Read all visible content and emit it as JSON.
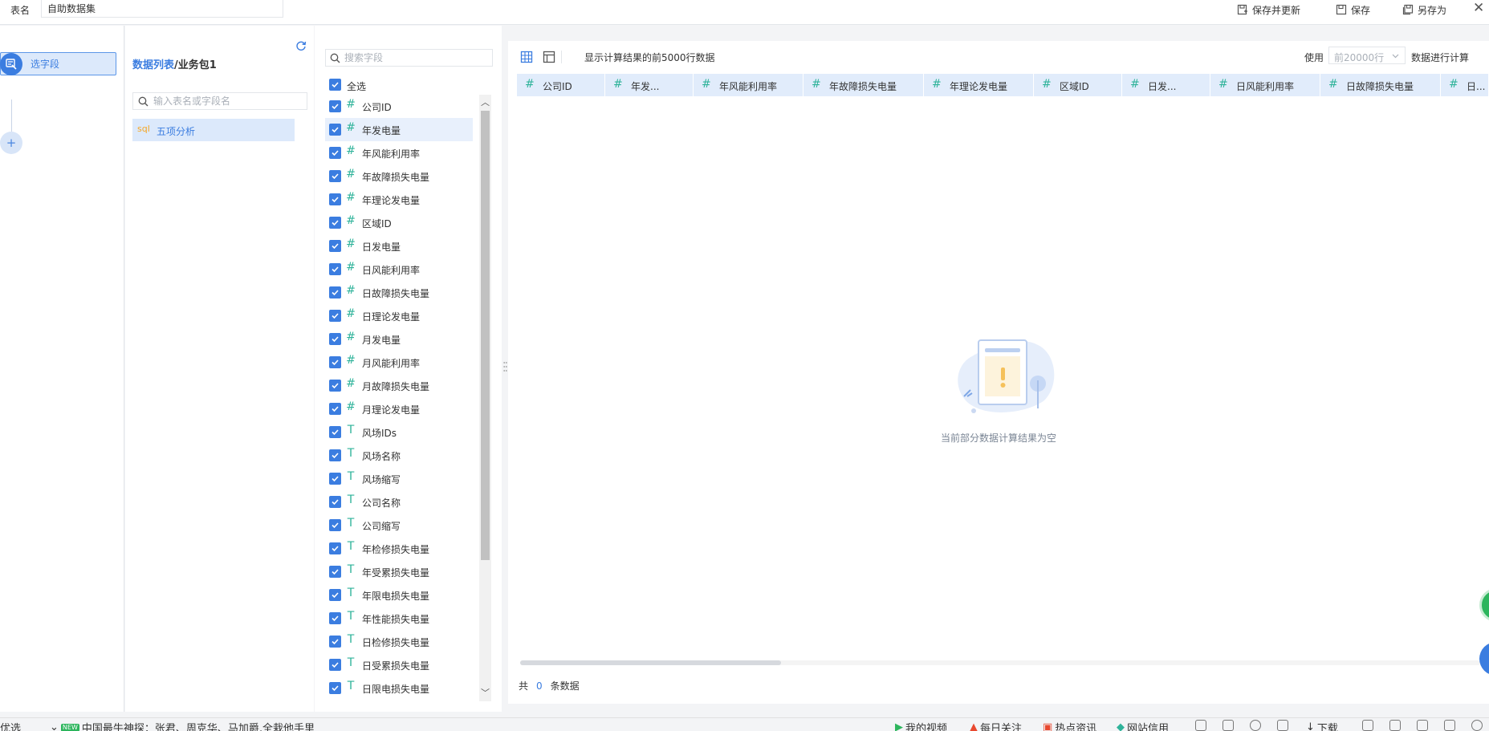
{
  "topbar": {
    "name_label": "表名",
    "name_value": "自助数据集",
    "save_update_label": "保存并更新",
    "save_label": "保存",
    "save_as_label": "另存为",
    "close_glyph": "✕"
  },
  "steps": {
    "active_label": "选字段",
    "add_glyph": "+"
  },
  "table_panel": {
    "title_link": "数据列表",
    "title_sep": "/",
    "title_rest": "业务包1",
    "search_placeholder": "输入表名或字段名",
    "tables": [
      {
        "badge": "sql",
        "name": "五项分析"
      }
    ]
  },
  "field_panel": {
    "search_placeholder": "搜索字段",
    "select_all_label": "全选",
    "fields": [
      {
        "type": "#",
        "name": "公司ID"
      },
      {
        "type": "#",
        "name": "年发电量"
      },
      {
        "type": "#",
        "name": "年风能利用率"
      },
      {
        "type": "#",
        "name": "年故障损失电量"
      },
      {
        "type": "#",
        "name": "年理论发电量"
      },
      {
        "type": "#",
        "name": "区域ID"
      },
      {
        "type": "#",
        "name": "日发电量"
      },
      {
        "type": "#",
        "name": "日风能利用率"
      },
      {
        "type": "#",
        "name": "日故障损失电量"
      },
      {
        "type": "#",
        "name": "日理论发电量"
      },
      {
        "type": "#",
        "name": "月发电量"
      },
      {
        "type": "#",
        "name": "月风能利用率"
      },
      {
        "type": "#",
        "name": "月故障损失电量"
      },
      {
        "type": "#",
        "name": "月理论发电量"
      },
      {
        "type": "T",
        "name": "风场IDs"
      },
      {
        "type": "T",
        "name": "风场名称"
      },
      {
        "type": "T",
        "name": "风场缩写"
      },
      {
        "type": "T",
        "name": "公司名称"
      },
      {
        "type": "T",
        "name": "公司缩写"
      },
      {
        "type": "T",
        "name": "年检修损失电量"
      },
      {
        "type": "T",
        "name": "年受累损失电量"
      },
      {
        "type": "T",
        "name": "年限电损失电量"
      },
      {
        "type": "T",
        "name": "年性能损失电量"
      },
      {
        "type": "T",
        "name": "日检修损失电量"
      },
      {
        "type": "T",
        "name": "日受累损失电量"
      },
      {
        "type": "T",
        "name": "日限电损失电量"
      }
    ],
    "selected_index": 1
  },
  "preview": {
    "info": "显示计算结果的前5000行数据",
    "use_label": "使用",
    "rows_select_value": "前20000行",
    "calc_label": "数据进行计算",
    "columns": [
      {
        "type": "#",
        "name": "公司ID"
      },
      {
        "type": "#",
        "name": "年发..."
      },
      {
        "type": "#",
        "name": "年风能利用率"
      },
      {
        "type": "#",
        "name": "年故障损失电量"
      },
      {
        "type": "#",
        "name": "年理论发电量"
      },
      {
        "type": "#",
        "name": "区域ID"
      },
      {
        "type": "#",
        "name": "日发..."
      },
      {
        "type": "#",
        "name": "日风能利用率"
      },
      {
        "type": "#",
        "name": "日故障损失电量"
      },
      {
        "type": "#",
        "name": "日..."
      }
    ],
    "empty_text": "当前部分数据计算结果为空",
    "count_prefix": "共",
    "count_value": "0",
    "count_suffix": "条数据"
  },
  "statusbar": {
    "left_text": "优选",
    "news_badge": "NEW",
    "news_text": "中国最牛神探：张君、周克华、马加爵,全栽他手里",
    "my_video": "我的视频",
    "daily_focus": "每日关注",
    "hot_news": "热点资讯",
    "site_trust": "网站信用",
    "download": "下载"
  },
  "colors": {
    "accent": "#3b7de0",
    "number_type": "#2fb39a",
    "selected_bg": "#dce9fb",
    "header_bg": "#e1ecfb"
  }
}
